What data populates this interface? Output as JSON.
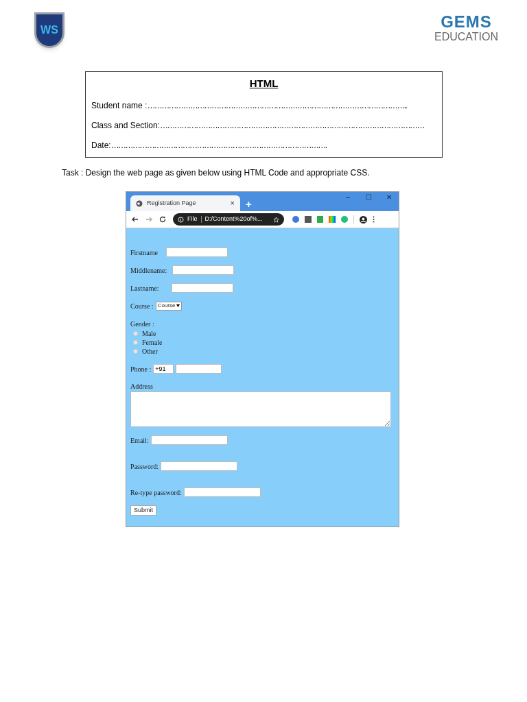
{
  "header": {
    "school_logo": "WS",
    "brand_logo": {
      "mark": "GEMS",
      "caption": "EDUCATION"
    }
  },
  "worksheet": {
    "title": "HTML",
    "fields": [
      {
        "label": "Student name : ",
        "fill": "……………………………………………………………………………………………….."
      },
      {
        "label": "Class and Section:",
        "fill": "…………………………………………………………………………………………………"
      },
      {
        "label": "Date: ",
        "fill": "………………………………………………………………………………."
      }
    ]
  },
  "task": "Task : Design  the web page as given below using HTML Code and appropriate CSS.",
  "browser": {
    "tab": {
      "title": "Registration Page",
      "close": "×"
    },
    "new_tab": "+",
    "window_controls": [
      "–",
      "☐",
      "✕"
    ],
    "address": {
      "scheme": "File",
      "url": "D:/Content%20of%..."
    },
    "form": {
      "firstname": {
        "label": "Firstname"
      },
      "middlename": {
        "label": "Middlename:"
      },
      "lastname": {
        "label": "Lastname:"
      },
      "course": {
        "label": "Course :",
        "value": "Course"
      },
      "gender": {
        "label": "Gender :",
        "options": [
          {
            "label": "Male",
            "selected": false
          },
          {
            "label": "Female",
            "selected": false
          },
          {
            "label": "Other",
            "selected": false
          }
        ]
      },
      "phone": {
        "label": "Phone :",
        "code": "+91"
      },
      "address": {
        "label": "Address"
      },
      "email": {
        "label": "Email:"
      },
      "password": {
        "label": "Password:"
      },
      "retype": {
        "label": "Re-type password:"
      },
      "submit": "Submit"
    }
  }
}
